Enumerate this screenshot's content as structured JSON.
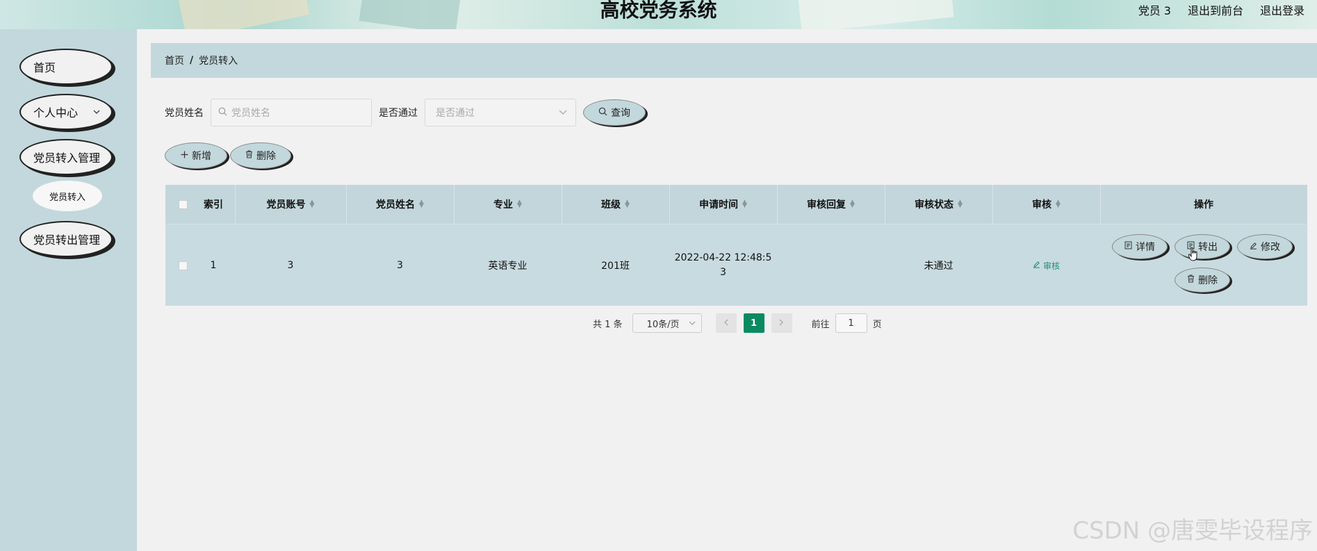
{
  "header": {
    "title": "高校党务系统",
    "user": "党员 3",
    "exit_front": "退出到前台",
    "logout": "退出登录"
  },
  "sidebar": {
    "items": [
      {
        "label": "首页"
      },
      {
        "label": "个人中心"
      },
      {
        "label": "党员转入管理"
      },
      {
        "label": "党员转出管理"
      }
    ],
    "sub_item": "党员转入"
  },
  "breadcrumb": {
    "home": "首页",
    "sep": "/",
    "current": "党员转入"
  },
  "search": {
    "name_label": "党员姓名",
    "name_placeholder": "党员姓名",
    "pass_label": "是否通过",
    "pass_placeholder": "是否通过",
    "query_button": "查询"
  },
  "actions": {
    "add": "新增",
    "delete": "删除"
  },
  "table": {
    "headers": [
      "索引",
      "党员账号",
      "党员姓名",
      "专业",
      "班级",
      "申请时间",
      "审核回复",
      "审核状态",
      "审核",
      "操作"
    ],
    "rows": [
      {
        "index": "1",
        "account": "3",
        "name": "3",
        "major": "英语专业",
        "class": "201班",
        "apply_time_line1": "2022-04-22 12:48:5",
        "apply_time_line2": "3",
        "reply": "",
        "status": "未通过",
        "audit": "审核",
        "ops": {
          "detail": "详情",
          "transfer": "转出",
          "edit": "修改",
          "delete": "删除"
        }
      }
    ]
  },
  "pagination": {
    "total": "共 1 条",
    "page_size": "10条/页",
    "current": "1",
    "goto_label": "前往",
    "goto_value": "1",
    "page_unit": "页"
  },
  "watermark": "CSDN @唐雯毕设程序",
  "colors": {
    "accent": "#0b8a62",
    "panel": "#c3d8dc",
    "background": "#f1f1f1"
  }
}
